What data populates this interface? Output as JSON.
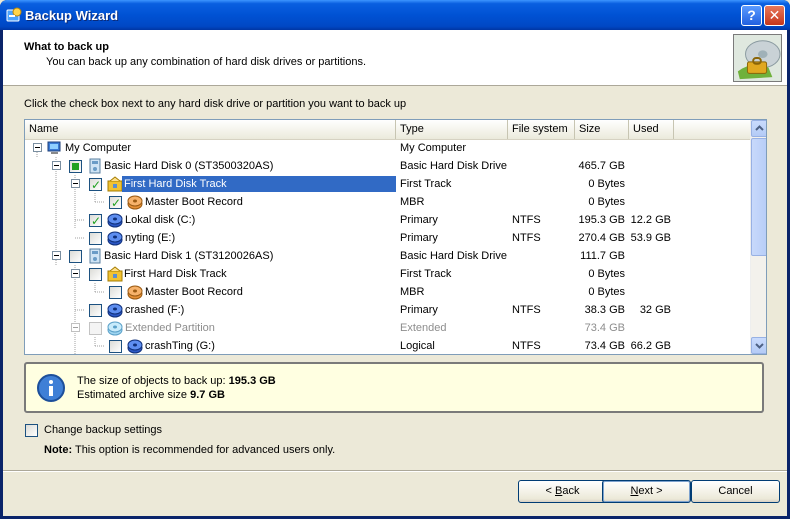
{
  "window": {
    "title": "Backup Wizard",
    "help_label": "?",
    "close_label": "✕"
  },
  "header": {
    "title": "What to back up",
    "subtitle": "You can back up any combination of hard disk drives or partitions."
  },
  "instruction": "Click the check box next to any hard disk drive or partition you want to back up",
  "tree": {
    "columns": [
      "Name",
      "Type",
      "File system",
      "Size",
      "Used"
    ],
    "rows": [
      {
        "name": "My Computer",
        "type": "My Computer",
        "fs": "",
        "size": "",
        "used": "",
        "icon": "computer-icon"
      },
      {
        "name": "Basic Hard Disk 0 (ST3500320AS)",
        "type": "Basic Hard Disk Drive",
        "fs": "",
        "size": "465.7 GB",
        "used": "",
        "icon": "hard-disk-icon",
        "check": "partial"
      },
      {
        "name": "First Hard Disk Track",
        "type": "First Track",
        "fs": "",
        "size": "0 Bytes",
        "used": "",
        "icon": "track-icon",
        "check": "checked",
        "selected": true
      },
      {
        "name": "Master Boot Record",
        "type": "MBR",
        "fs": "",
        "size": "0 Bytes",
        "used": "",
        "icon": "mbr-icon",
        "check": "checked"
      },
      {
        "name": "Lokal disk (C:)",
        "type": "Primary",
        "fs": "NTFS",
        "size": "195.3 GB",
        "used": "12.2 GB",
        "icon": "partition-icon",
        "check": "checked"
      },
      {
        "name": "nyting (E:)",
        "type": "Primary",
        "fs": "NTFS",
        "size": "270.4 GB",
        "used": "53.9 GB",
        "icon": "partition-icon",
        "check": "unchecked"
      },
      {
        "name": "Basic Hard Disk 1 (ST3120026AS)",
        "type": "Basic Hard Disk Drive",
        "fs": "",
        "size": "111.7 GB",
        "used": "",
        "icon": "hard-disk-icon",
        "check": "unchecked"
      },
      {
        "name": "First Hard Disk Track",
        "type": "First Track",
        "fs": "",
        "size": "0 Bytes",
        "used": "",
        "icon": "track-icon",
        "check": "unchecked"
      },
      {
        "name": "Master Boot Record",
        "type": "MBR",
        "fs": "",
        "size": "0 Bytes",
        "used": "",
        "icon": "mbr-icon",
        "check": "unchecked"
      },
      {
        "name": "crashed (F:)",
        "type": "Primary",
        "fs": "NTFS",
        "size": "38.3 GB",
        "used": "32 GB",
        "icon": "partition-icon",
        "check": "unchecked"
      },
      {
        "name": "Extended Partition",
        "type": "Extended",
        "fs": "",
        "size": "73.4 GB",
        "used": "",
        "icon": "extended-partition-icon",
        "check": "disabled",
        "disabled": true
      },
      {
        "name": "crashTing (G:)",
        "type": "Logical",
        "fs": "NTFS",
        "size": "73.4 GB",
        "used": "66.2 GB",
        "icon": "partition-icon",
        "check": "unchecked"
      }
    ]
  },
  "info": {
    "line1_label": "The size of objects to back up:",
    "line1_value": "195.3 GB",
    "line2_label": "Estimated archive size",
    "line2_value": "9.7 GB"
  },
  "settings": {
    "checkbox_label": "Change backup settings",
    "note_label": "Note:",
    "note_text": "This option is recommended for advanced users only."
  },
  "buttons": {
    "back_prefix": "< ",
    "back_key": "B",
    "back_rest": "ack",
    "next_key": "N",
    "next_rest": "ext >",
    "cancel_label": "Cancel"
  },
  "colors": {
    "title_bar": "#0054e3",
    "selection": "#316ac5",
    "info_bg": "#ffffe1",
    "dialog_bg": "#ece9d8"
  }
}
